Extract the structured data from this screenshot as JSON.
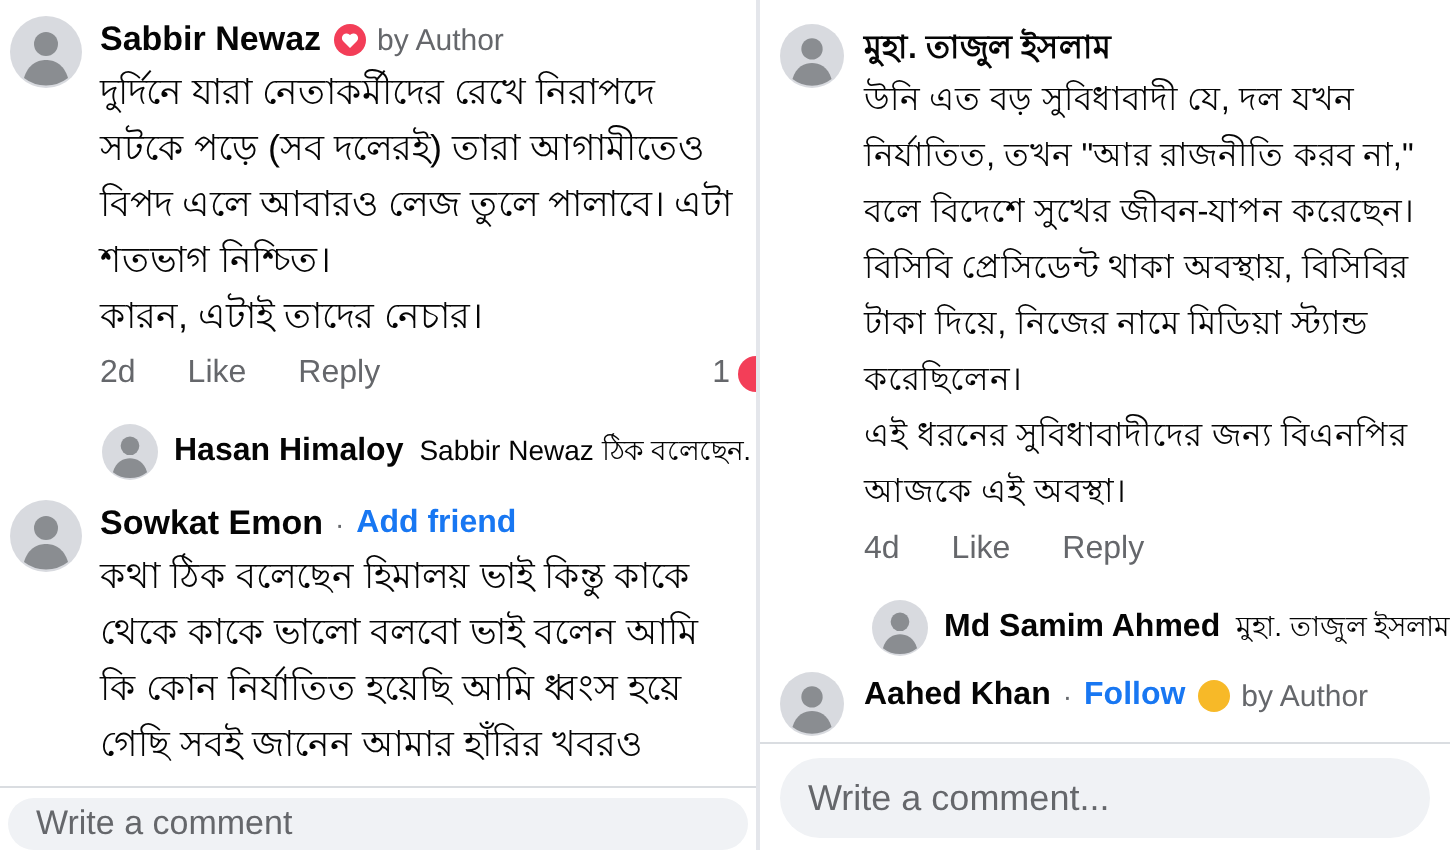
{
  "panels": [
    {
      "comments": [
        {
          "name": "Sabbir Newaz",
          "badge": {
            "kind": "author",
            "text": "by Author"
          },
          "text": "দুর্দিনে যারা নেতাকর্মীদের রেখে নিরাপদে\nসটকে পড়ে (সব দলেরই) তারা আগামীতেও\nবিপদ এলে আবারও লেজ তুলে পালাবে। এটা\nশতভাগ নিশ্চিত।\nকারন, এটাই তাদের নেচার।",
          "time": "2d",
          "actions": [
            "Like",
            "Reply"
          ],
          "reaction_count": "1",
          "replies": [
            {
              "name": "Hasan Himaloy",
              "text": "Sabbir Newaz ঠিক বলেছেন."
            }
          ]
        },
        {
          "name": "Sowkat Emon",
          "separator": "·",
          "link": "Add friend",
          "text": "কথা ঠিক বলেছেন হিমালয় ভাই কিন্তু কাকে\nথেকে কাকে ভালো বলবো ভাই বলেন আমি\nকি কোন নির্যাতিত হয়েছি আমি ধ্বংস হয়ে\nগেছি সবই জানেন আমার হাঁরির খবরও"
        }
      ],
      "composer": {
        "placeholder": "Write a comment"
      }
    },
    {
      "comments": [
        {
          "name": "মুহা. তাজুল ইসলাম",
          "text": "উনি এত বড় সুবিধাবাদী যে, দল যখন\nনির্যাতিত, তখন \"আর রাজনীতি করব না,\"\nবলে বিদেশে সুখের জীবন-যাপন করেছেন।\nবিসিবি প্রেসিডেন্ট থাকা অবস্থায়, বিসিবির\nটাকা দিয়ে, নিজের নামে মিডিয়া স্ট্যান্ড\nকরেছিলেন।\nএই ধরনের সুবিধাবাদীদের জন্য বিএনপির\nআজকে এই অবস্থা।",
          "time": "4d",
          "actions": [
            "Like",
            "Reply"
          ],
          "replies": [
            {
              "name": "Md Samim Ahmed",
              "text": "মুহা. তাজুল ইসলাম"
            }
          ]
        },
        {
          "name": "Aahed Khan",
          "separator": "·",
          "link": "Follow",
          "badge": {
            "kind": "emoji",
            "text": "by Author"
          }
        }
      ],
      "composer": {
        "placeholder": "Write a comment..."
      }
    }
  ]
}
